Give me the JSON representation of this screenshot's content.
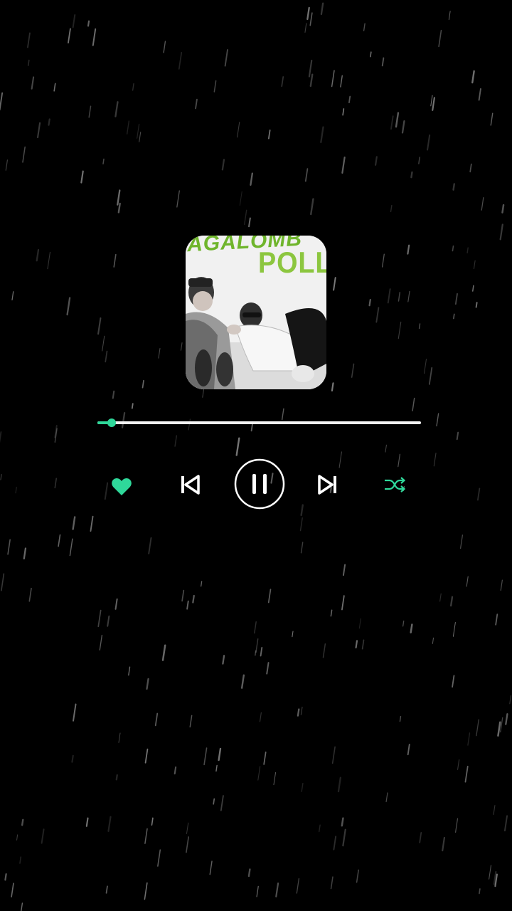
{
  "player": {
    "album_art": {
      "cover_title_top": "AGALOMB",
      "cover_title_main": "POLLO"
    },
    "progress": {
      "fraction": 0.045
    },
    "controls": {
      "like_icon": "heart-icon",
      "previous_icon": "skip-previous-icon",
      "play_pause_icon": "pause-icon",
      "next_icon": "skip-next-icon",
      "shuffle_icon": "shuffle-icon"
    }
  },
  "colors": {
    "background": "#000000",
    "accent": "#2fd89a",
    "track": "#f4f4f4",
    "controls": "#ffffff",
    "cover_text": "#8cc63f"
  }
}
